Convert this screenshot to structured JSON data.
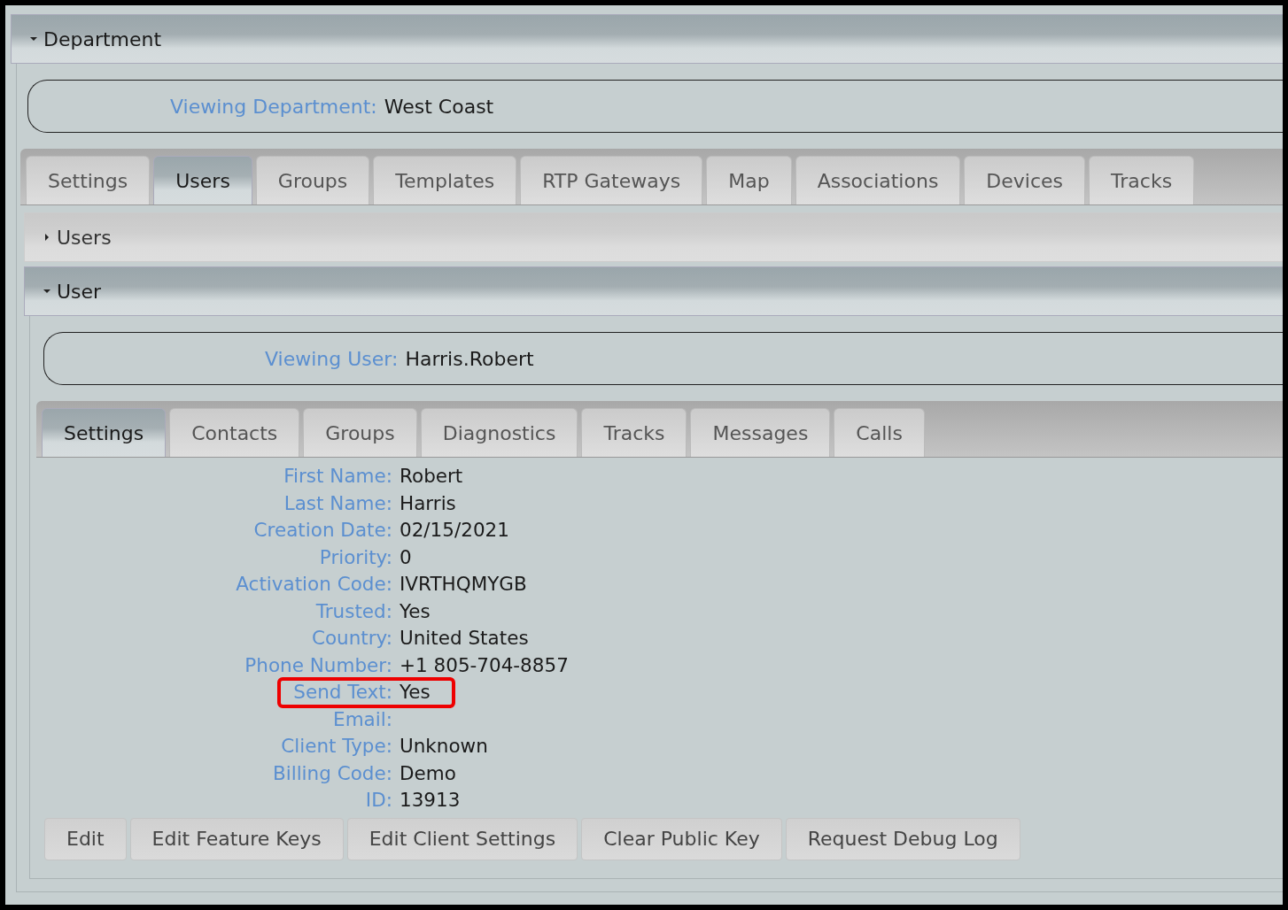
{
  "department_section": {
    "title": "Department",
    "expanded": true
  },
  "department_view": {
    "label": "Viewing Department:",
    "value": "West Coast"
  },
  "department_tabs": [
    {
      "label": "Settings",
      "selected": false
    },
    {
      "label": "Users",
      "selected": true
    },
    {
      "label": "Groups",
      "selected": false
    },
    {
      "label": "Templates",
      "selected": false
    },
    {
      "label": "RTP Gateways",
      "selected": false
    },
    {
      "label": "Map",
      "selected": false
    },
    {
      "label": "Associations",
      "selected": false
    },
    {
      "label": "Devices",
      "selected": false
    },
    {
      "label": "Tracks",
      "selected": false
    }
  ],
  "sections": [
    {
      "title": "Users",
      "expanded": false
    },
    {
      "title": "User",
      "expanded": true
    }
  ],
  "user_view": {
    "label": "Viewing User:",
    "value": "Harris.Robert"
  },
  "user_tabs": [
    {
      "label": "Settings",
      "selected": true
    },
    {
      "label": "Contacts",
      "selected": false
    },
    {
      "label": "Groups",
      "selected": false
    },
    {
      "label": "Diagnostics",
      "selected": false
    },
    {
      "label": "Tracks",
      "selected": false
    },
    {
      "label": "Messages",
      "selected": false
    },
    {
      "label": "Calls",
      "selected": false
    }
  ],
  "fields": [
    {
      "label": "First Name:",
      "value": "Robert",
      "highlighted": false
    },
    {
      "label": "Last Name:",
      "value": "Harris",
      "highlighted": false
    },
    {
      "label": "Creation Date:",
      "value": "02/15/2021",
      "highlighted": false
    },
    {
      "label": "Priority:",
      "value": "0",
      "highlighted": false
    },
    {
      "label": "Activation Code:",
      "value": "IVRTHQMYGB",
      "highlighted": false
    },
    {
      "label": "Trusted:",
      "value": "Yes",
      "highlighted": false
    },
    {
      "label": "Country:",
      "value": "United States",
      "highlighted": false
    },
    {
      "label": "Phone Number:",
      "value": "+1 805-704-8857",
      "highlighted": false
    },
    {
      "label": "Send Text:",
      "value": "Yes",
      "highlighted": true
    },
    {
      "label": "Email:",
      "highlighted": false
    },
    {
      "label": "Client Type:",
      "value": "Unknown",
      "highlighted": false
    },
    {
      "label": "Billing Code:",
      "value": "Demo",
      "highlighted": false
    },
    {
      "label": "ID:",
      "value": "13913",
      "highlighted": false
    }
  ],
  "buttons": [
    "Edit",
    "Edit Feature Keys",
    "Edit Client Settings",
    "Clear Public Key",
    "Request Debug Log"
  ]
}
